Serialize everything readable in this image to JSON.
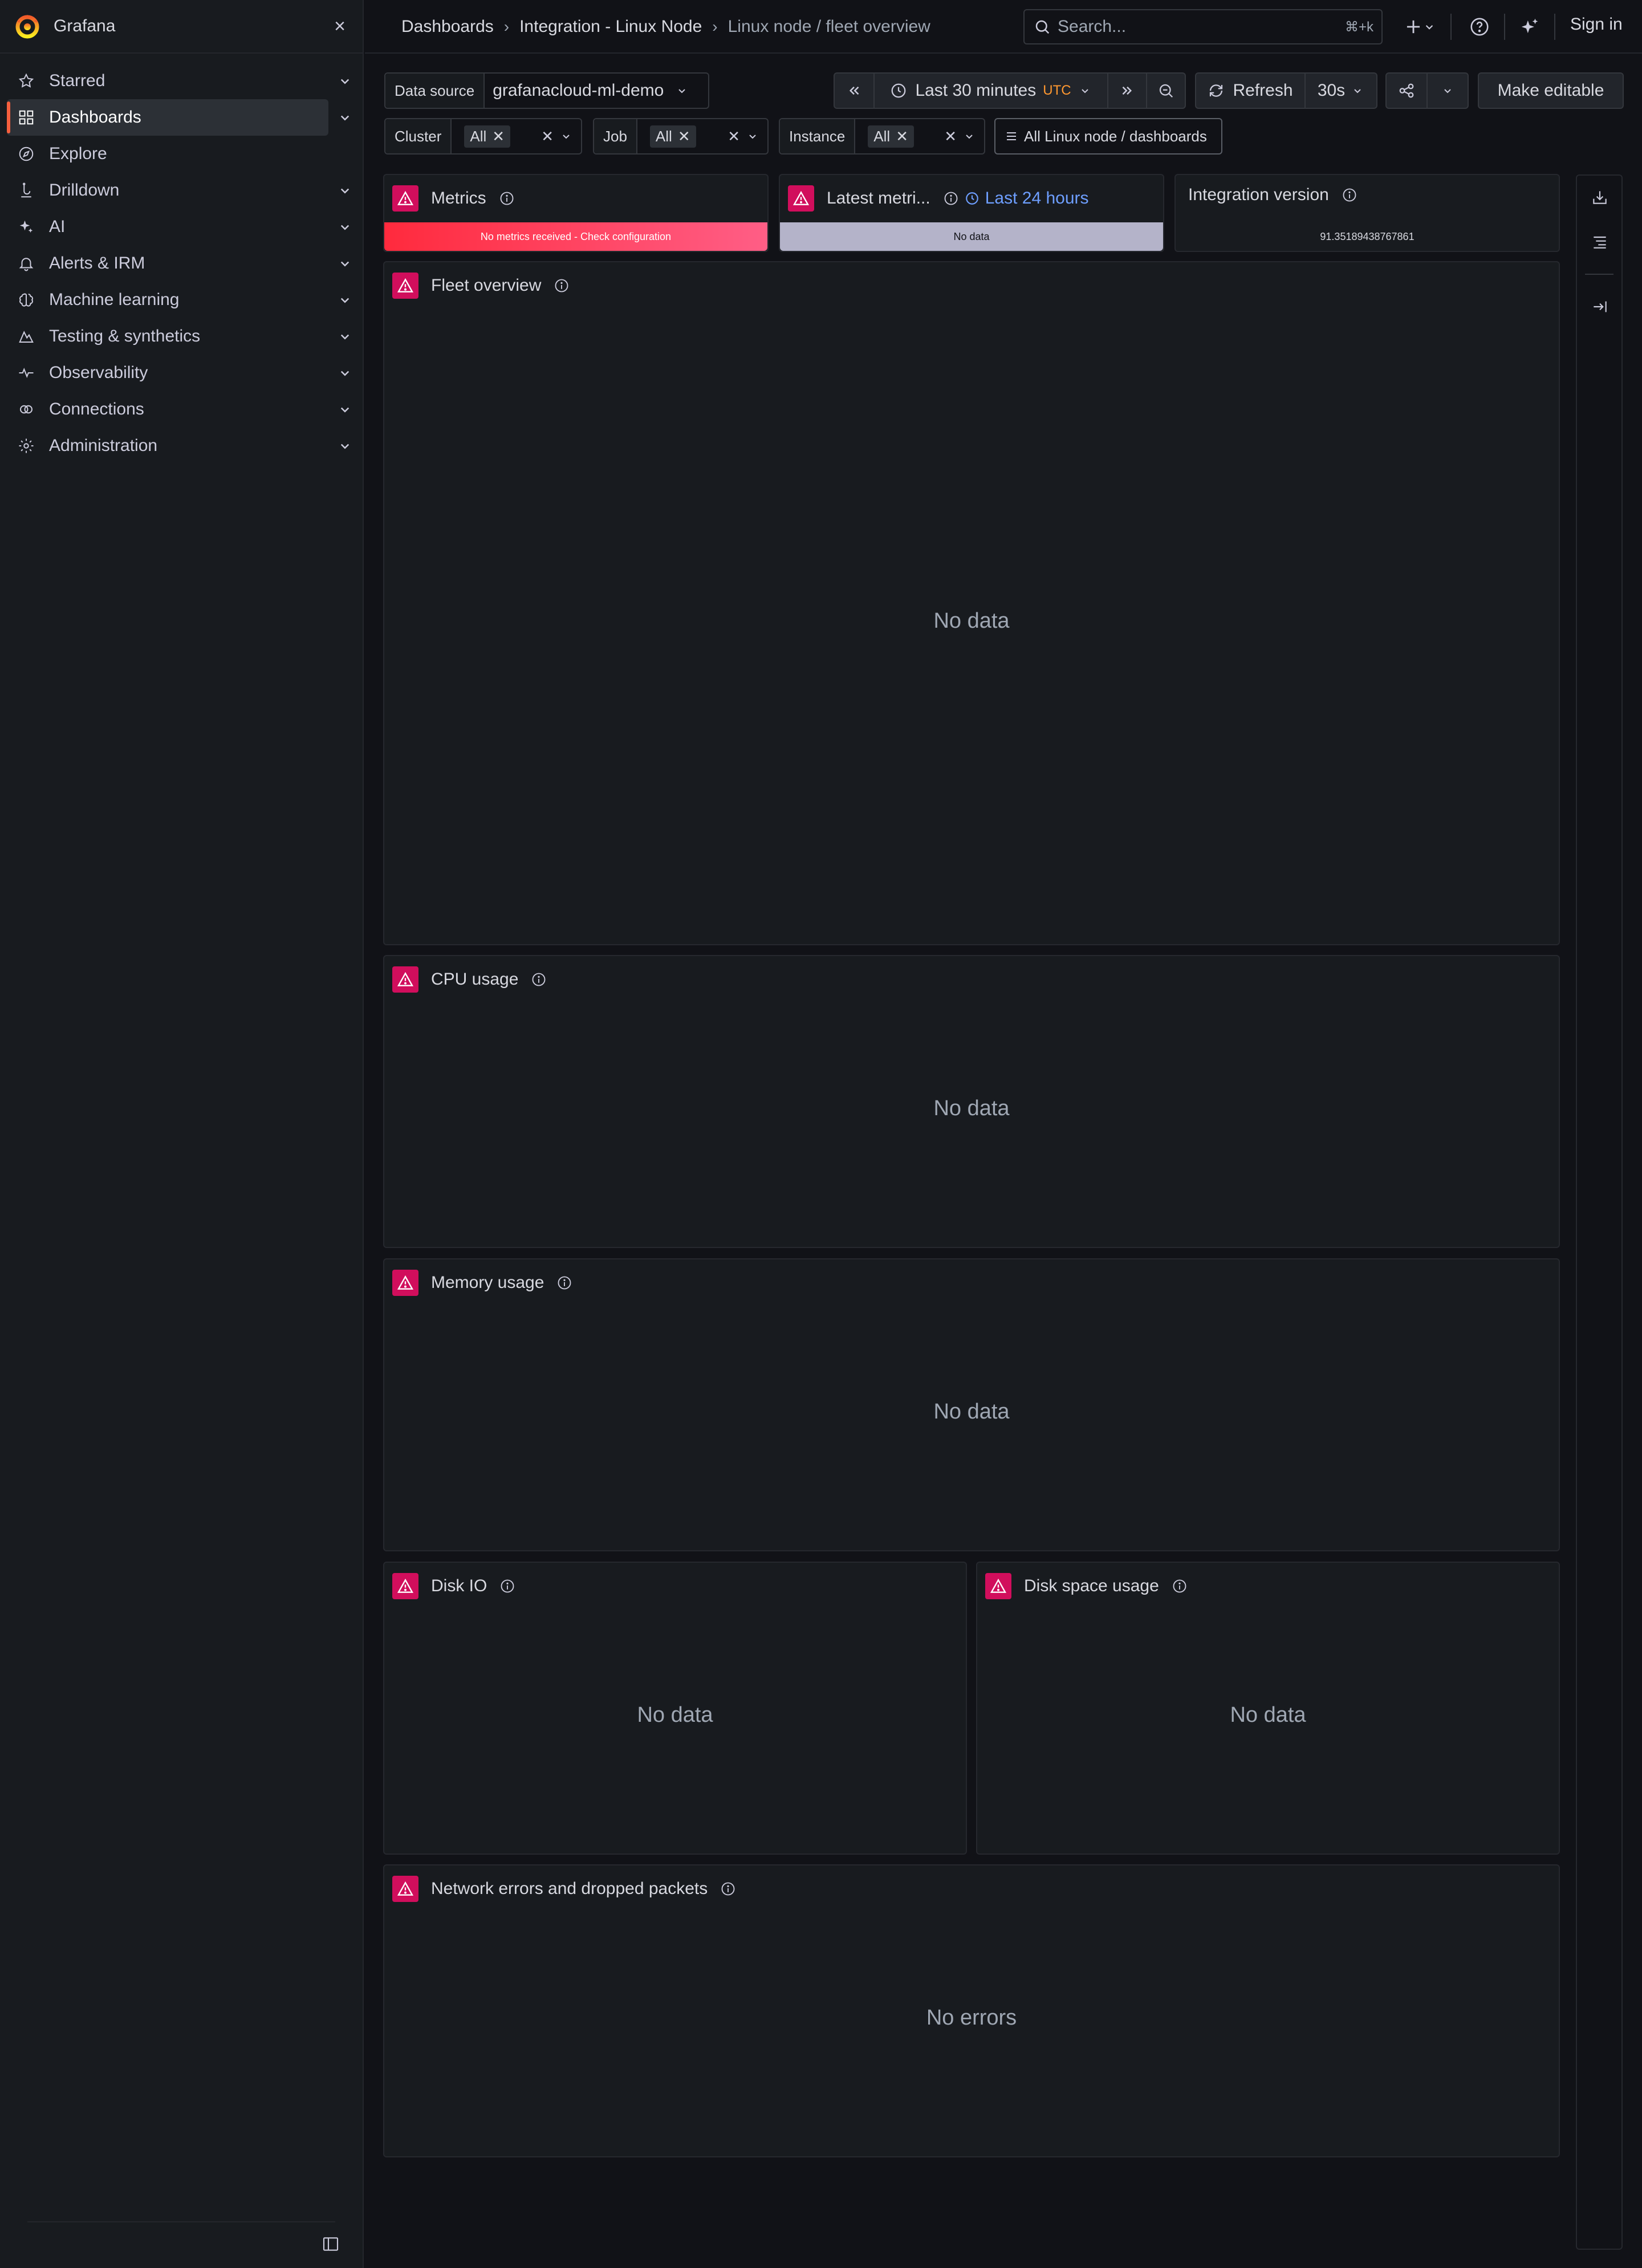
{
  "app": {
    "brand": "Grafana"
  },
  "sidebar": {
    "items": [
      {
        "label": "Starred",
        "icon": "star-icon",
        "active": false
      },
      {
        "label": "Dashboards",
        "icon": "apps-icon",
        "active": true
      },
      {
        "label": "Explore",
        "icon": "compass-icon",
        "active": false
      },
      {
        "label": "Drilldown",
        "icon": "drilldown-icon",
        "active": false
      },
      {
        "label": "AI",
        "icon": "sparkle-icon",
        "active": false
      },
      {
        "label": "Alerts & IRM",
        "icon": "bell-icon",
        "active": false
      },
      {
        "label": "Machine learning",
        "icon": "brain-icon",
        "active": false
      },
      {
        "label": "Testing & synthetics",
        "icon": "k6-icon",
        "active": false
      },
      {
        "label": "Observability",
        "icon": "heartbeat-icon",
        "active": false
      },
      {
        "label": "Connections",
        "icon": "plug-icon",
        "active": false
      },
      {
        "label": "Administration",
        "icon": "cog-icon",
        "active": false
      }
    ]
  },
  "topbar": {
    "breadcrumbs": [
      "Dashboards",
      "Integration - Linux Node",
      "Linux node / fleet overview"
    ],
    "search": {
      "placeholder": "Search...",
      "shortcut": "⌘+k"
    },
    "signin": "Sign in"
  },
  "controls": {
    "datasource": {
      "label": "Data source",
      "value": "grafanacloud-ml-demo"
    },
    "time": {
      "range": "Last 30 minutes",
      "tz": "UTC"
    },
    "refresh": {
      "label": "Refresh",
      "interval": "30s"
    },
    "make_editable": "Make editable",
    "variables": [
      {
        "label": "Cluster",
        "value": "All"
      },
      {
        "label": "Job",
        "value": "All"
      },
      {
        "label": "Instance",
        "value": "All"
      }
    ],
    "dash_link": "All Linux node / dashboards"
  },
  "panels": {
    "metrics": {
      "title": "Metrics",
      "status": "No metrics received - Check configuration",
      "color": "#ff3347"
    },
    "latest": {
      "title": "Latest metri...",
      "override": "Last 24 hours",
      "status": "No data"
    },
    "integration": {
      "title": "Integration version",
      "value": "91.35189438767861"
    },
    "fleet": {
      "title": "Fleet overview",
      "empty": "No data"
    },
    "cpu": {
      "title": "CPU usage",
      "empty": "No data"
    },
    "memory": {
      "title": "Memory usage",
      "empty": "No data"
    },
    "diskio": {
      "title": "Disk IO",
      "empty": "No data"
    },
    "diskspace": {
      "title": "Disk space usage",
      "empty": "No data"
    },
    "network": {
      "title": "Network errors and dropped packets",
      "empty": "No errors"
    }
  },
  "colors": {
    "accent": "#f55f3e",
    "error": "#d10e5c",
    "link": "#6e9fff",
    "utc": "#ff9830"
  }
}
